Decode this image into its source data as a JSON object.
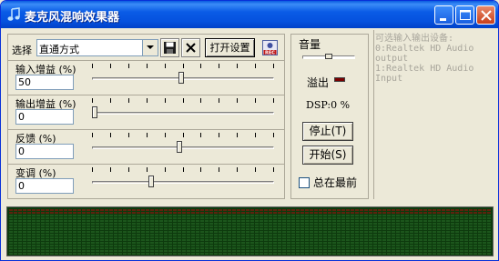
{
  "window": {
    "title": "麦克风混响效果器",
    "icons": {
      "app": "music-note-icon",
      "minimize": "minimize-icon",
      "maximize": "maximize-icon",
      "close": "close-icon"
    }
  },
  "toolbar": {
    "preset_label": "选择",
    "preset_value": "直通方式",
    "open_settings_label": "打开设置",
    "icons": {
      "dropdown": "chevron-down-icon",
      "save": "save-icon",
      "clear": "delete-icon",
      "rec": "rec-icon"
    }
  },
  "controls": [
    {
      "label": "输入增益 (%)",
      "value": "50",
      "level": 0.49
    },
    {
      "label": "输出增益 (%)",
      "value": "0",
      "level": 0.0
    },
    {
      "label": "反馈 (%)",
      "value": "0",
      "level": 0.48
    },
    {
      "label": "变调 (%)",
      "value": "0",
      "level": 0.32
    }
  ],
  "volume": {
    "label": "音量",
    "level": 0.5,
    "overflow_label": "溢出",
    "dsp_text": "DSP:0 %",
    "stop_label": "停止(T)",
    "start_label": "开始(S)",
    "always_on_top_label": "总在最前",
    "always_on_top_checked": false
  },
  "devices": {
    "text": "可选输入输出设备:\n0:Realtek HD Audio\noutput\n1:Realtek HD Audio\nInput"
  },
  "colors": {
    "titlebar": "#0a5ce6",
    "visualizer_bg": "#0d3a0d",
    "visualizer_grid": "#2f7a2f",
    "visualizer_peak": "#a01010",
    "overflow_led": "#7a0000"
  }
}
